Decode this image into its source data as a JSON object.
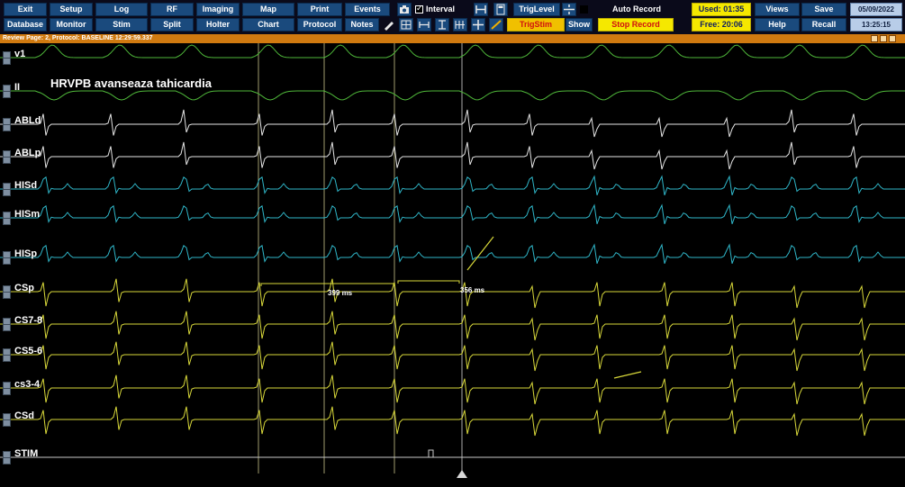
{
  "toolbar": {
    "row1": [
      {
        "key": "exit",
        "label": "Exit"
      },
      {
        "key": "setup",
        "label": "Setup"
      },
      {
        "key": "log",
        "label": "Log"
      },
      {
        "key": "rf",
        "label": "RF"
      },
      {
        "key": "imaging",
        "label": "Imaging"
      },
      {
        "key": "map",
        "label": "Map"
      },
      {
        "key": "print",
        "label": "Print"
      },
      {
        "key": "events",
        "label": "Events"
      }
    ],
    "row2": [
      {
        "key": "database",
        "label": "Database"
      },
      {
        "key": "monitor",
        "label": "Monitor"
      },
      {
        "key": "stim",
        "label": "Stim"
      },
      {
        "key": "split",
        "label": "Split"
      },
      {
        "key": "holter",
        "label": "Holter"
      },
      {
        "key": "chart",
        "label": "Chart"
      },
      {
        "key": "protocol",
        "label": "Protocol"
      },
      {
        "key": "notes",
        "label": "Notes"
      }
    ],
    "interval_label": "Interval",
    "interval_checked": true,
    "triglevel_label": "TrigLevel",
    "trigstim_label": "TrigStim",
    "show_label": "Show",
    "auto_record_label": "Auto Record",
    "stop_record_label": "Stop Record",
    "used_label": "Used: 01:35",
    "free_label": "Free: 20:06",
    "views_label": "Views",
    "save_label": "Save",
    "help_label": "Help",
    "recall_label": "Recall",
    "date": "05/09/2022",
    "time": "13:25:15"
  },
  "review_bar": {
    "text": "Review Page: 2, Protocol: BASELINE   12:29:59.337"
  },
  "channels": [
    {
      "name": "v1",
      "color": "#4fb83a"
    },
    {
      "name": "II",
      "color": "#4fb83a"
    },
    {
      "name": "ABLd",
      "color": "#e6e6e6"
    },
    {
      "name": "ABLp",
      "color": "#e6e6e6"
    },
    {
      "name": "HISd",
      "color": "#2fb6c8"
    },
    {
      "name": "HISm",
      "color": "#2fb6c8"
    },
    {
      "name": "HISp",
      "color": "#2fb6c8"
    },
    {
      "name": "CSp",
      "color": "#d8d83a"
    },
    {
      "name": "CS7-8",
      "color": "#d8d83a"
    },
    {
      "name": "CS5-6",
      "color": "#d8d83a"
    },
    {
      "name": "cs3-4",
      "color": "#d8d83a"
    },
    {
      "name": "CSd",
      "color": "#d8d83a"
    },
    {
      "name": "STIM",
      "color": "#c8c8c8"
    }
  ],
  "annotation": "HRVPB avanseaza tahicardia",
  "measurements": [
    {
      "label": "399 ms"
    },
    {
      "label": "356 ms"
    }
  ]
}
